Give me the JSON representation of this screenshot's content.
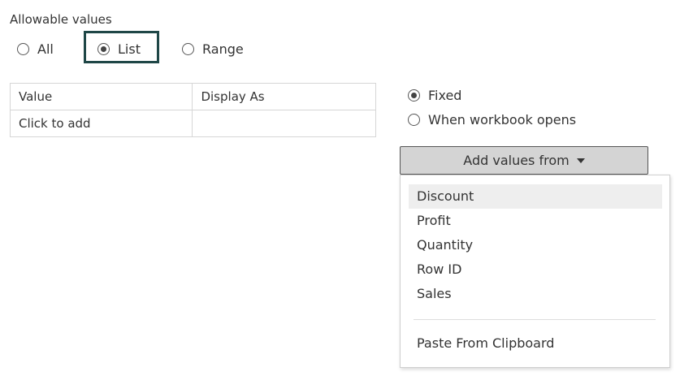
{
  "allowable_values": {
    "label": "Allowable values",
    "options": [
      {
        "label": "All",
        "selected": false
      },
      {
        "label": "List",
        "selected": true
      },
      {
        "label": "Range",
        "selected": false
      }
    ]
  },
  "values_table": {
    "columns": [
      "Value",
      "Display As"
    ],
    "rows": [
      {
        "value": "Click to add",
        "display_as": ""
      }
    ]
  },
  "value_source": {
    "options": [
      {
        "label": "Fixed",
        "selected": true
      },
      {
        "label": "When workbook opens",
        "selected": false
      }
    ]
  },
  "add_values_button": {
    "label": "Add values from",
    "icon": "caret-down-icon"
  },
  "dropdown": {
    "items": [
      "Discount",
      "Profit",
      "Quantity",
      "Row ID",
      "Sales"
    ],
    "hovered_item": "Discount",
    "footer_item": "Paste From Clipboard"
  },
  "colors": {
    "highlight_border": "#1f4747",
    "button_bg": "#d4d4d4",
    "hover_bg": "#eeeeee"
  }
}
